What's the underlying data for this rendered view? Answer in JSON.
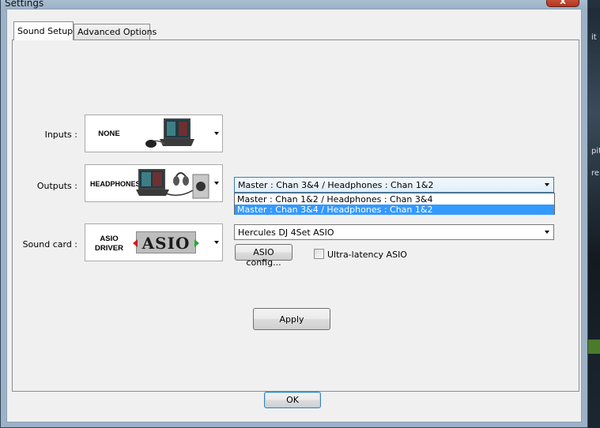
{
  "window": {
    "title": "Settings",
    "close_glyph": "x"
  },
  "background": {
    "right_texts": [
      "it",
      "pit",
      "re"
    ]
  },
  "tabs": [
    {
      "label": "Sound Setup",
      "active": true
    },
    {
      "label": "Advanced Options",
      "active": false
    }
  ],
  "inputs": {
    "label": "Inputs :",
    "caption": "NONE"
  },
  "outputs": {
    "label": "Outputs :",
    "caption": "HEADPHONES",
    "selected_value": "Master : Chan 3&4 / Headphones : Chan 1&2",
    "options": [
      "Master : Chan 1&2 / Headphones : Chan 3&4",
      "Master : Chan 3&4 / Headphones : Chan 1&2"
    ],
    "highlighted_index": 1
  },
  "sound_card": {
    "label": "Sound card :",
    "caption_line1": "ASIO",
    "caption_line2": "DRIVER",
    "logo_text": "ASIO",
    "selected_value": "Hercules DJ 4Set ASIO",
    "asio_config_label": "ASIO config...",
    "ultra_latency_label": "Ultra-latency ASIO",
    "ultra_latency_checked": false
  },
  "buttons": {
    "apply": "Apply",
    "ok": "OK"
  },
  "colors": {
    "selection": "#3399ff",
    "focus_border": "#3c7fb1"
  }
}
